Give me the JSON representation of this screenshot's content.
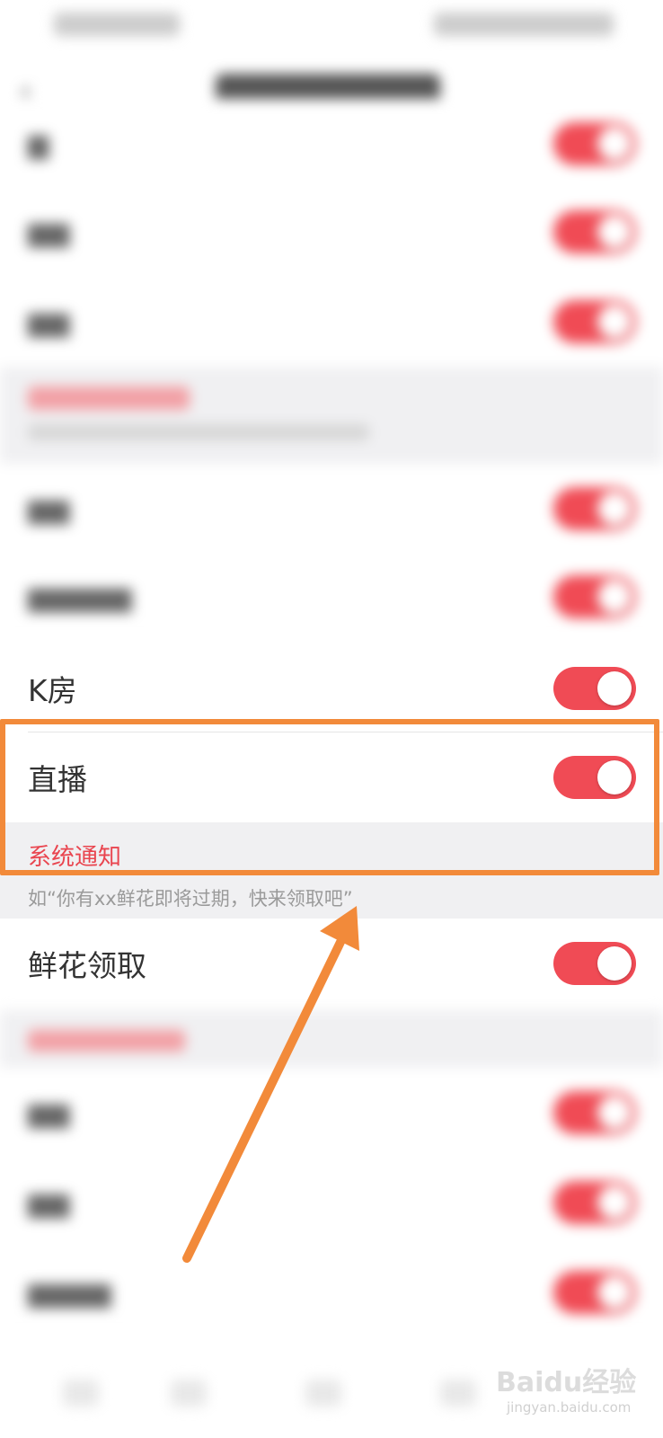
{
  "header": {
    "back_icon": "back-arrow-icon"
  },
  "rows_visible": {
    "k_room": {
      "label": "K房",
      "toggle_on": true
    },
    "live": {
      "label": "直播",
      "toggle_on": true
    },
    "flower": {
      "label": "鲜花领取",
      "toggle_on": true
    }
  },
  "system_section": {
    "title": "系统通知",
    "subtitle": "如“你有xx鲜花即将过期，快来领取吧”"
  },
  "watermark": {
    "logo": "Baidu经验",
    "sub": "jingyan.baidu.com"
  },
  "colors": {
    "accent": "#f04b55",
    "section_title": "#e9454f",
    "highlight": "#f28a3a",
    "section_bg": "#f0f0f2"
  }
}
